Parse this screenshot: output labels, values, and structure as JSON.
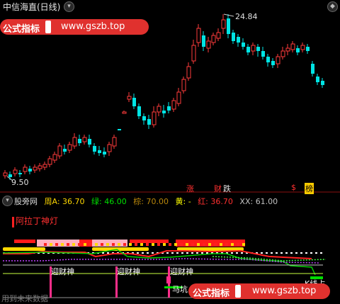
{
  "window": {
    "title": "中信海直(日线)"
  },
  "brand": {
    "label": "公式指标",
    "url": "www.gszb.top"
  },
  "main_chart": {
    "high_label": "24.84",
    "low_label": "9.50",
    "signals": [
      "涨",
      "财",
      "跌",
      "$",
      "榜"
    ]
  },
  "indicator": {
    "name": "股旁网",
    "fields": [
      {
        "label": "周A:",
        "value": "36.70",
        "color": "#ffd800"
      },
      {
        "label": "绿:",
        "value": "46.00",
        "color": "#00e000"
      },
      {
        "label": "棕:",
        "value": "70.00",
        "color": "#b8860b"
      },
      {
        "label": "黄:",
        "value": "-",
        "color": "#ffff00"
      },
      {
        "label": "红:",
        "value": "36.70",
        "color": "#ff3030"
      },
      {
        "label": "XX:",
        "value": "61.00",
        "color": "#c0c0c0"
      }
    ],
    "top_label": "阿拉丁神灯",
    "annotations": [
      "迎财神",
      "迎财神",
      "迎财神",
      "马坑",
      "K线占"
    ],
    "watermark": "用到未来数据"
  },
  "colors": {
    "up": "#ff3b3b",
    "down": "#00e5e5",
    "brand": "#e0312e"
  }
}
